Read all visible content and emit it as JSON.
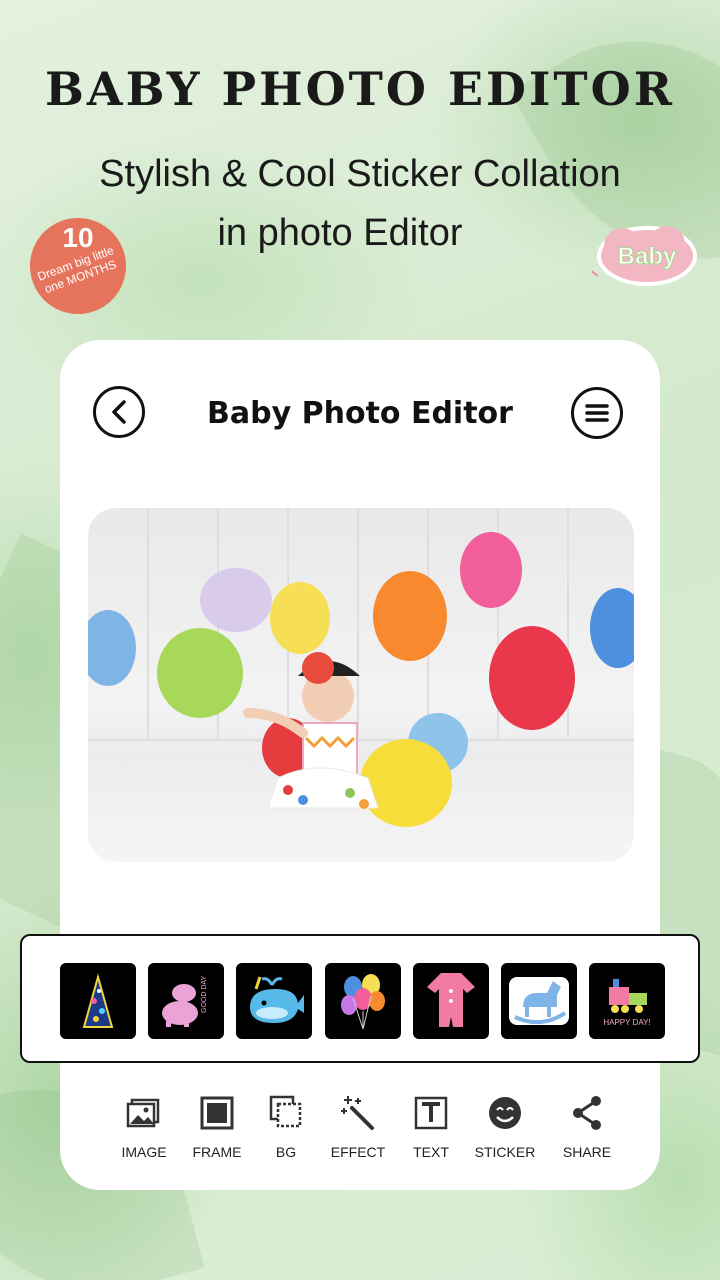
{
  "hero": {
    "title": "BABY PHOTO EDITOR",
    "subtitle_line1": "Stylish & Cool Sticker Collation",
    "subtitle_line2": "in photo Editor"
  },
  "badges": {
    "months_number": "10",
    "months_text": "Dream big little one MONTHS",
    "baby_text": "Baby"
  },
  "editor": {
    "title": "Baby Photo Editor",
    "back_icon": "back-arrow-icon",
    "menu_icon": "menu-lines-icon"
  },
  "stickers": [
    {
      "name": "party-hat-sticker"
    },
    {
      "name": "elephants-sticker",
      "text": "GOOD DAY"
    },
    {
      "name": "whale-sticker"
    },
    {
      "name": "balloons-sticker"
    },
    {
      "name": "baby-onesie-sticker"
    },
    {
      "name": "rocking-horse-sticker"
    },
    {
      "name": "toy-train-sticker",
      "text": "HAPPY DAY!"
    }
  ],
  "toolbar": {
    "image": "IMAGE",
    "frame": "FRAME",
    "bg": "BG",
    "effect": "EFFECT",
    "text": "TEXT",
    "sticker": "STICKER",
    "share": "SHARE"
  },
  "colors": {
    "background": "#d9ecd3",
    "card": "#ffffff",
    "text": "#111111"
  }
}
